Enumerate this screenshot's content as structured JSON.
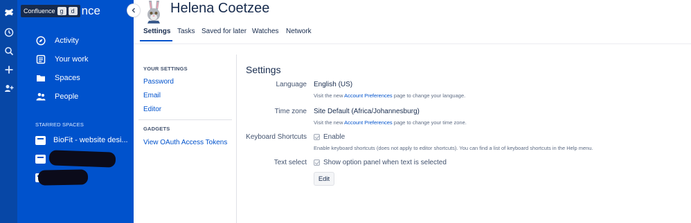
{
  "rail": {
    "icons": [
      "confluence-logo",
      "recent-icon",
      "search-icon",
      "create-icon",
      "invite-people-icon"
    ]
  },
  "sidebar": {
    "tooltip": {
      "label": "Confluence",
      "key1": "g",
      "key2": "d"
    },
    "brand_partial": "nce",
    "nav": [
      {
        "icon": "compass-icon",
        "label": "Activity"
      },
      {
        "icon": "document-icon",
        "label": "Your work"
      },
      {
        "icon": "folder-icon",
        "label": "Spaces"
      },
      {
        "icon": "people-icon",
        "label": "People"
      }
    ],
    "starred_heading": "STARRED SPACES",
    "starred": [
      {
        "label": "BioFit - website desi..."
      }
    ]
  },
  "header": {
    "name": "Helena Coetzee",
    "tabs": [
      "Settings",
      "Tasks",
      "Saved for later",
      "Watches",
      "Network"
    ],
    "active_tab": "Settings"
  },
  "menu": {
    "your_settings_heading": "YOUR SETTINGS",
    "your_settings": [
      "Password",
      "Email",
      "Editor"
    ],
    "gadgets_heading": "GADGETS",
    "gadgets": [
      "View OAuth Access Tokens"
    ]
  },
  "settings": {
    "title": "Settings",
    "language": {
      "label": "Language",
      "value": "English (US)",
      "help_pre": "Visit the new",
      "help_link": "Account Preferences",
      "help_post": "page to change your language."
    },
    "timezone": {
      "label": "Time zone",
      "value": "Site Default (Africa/Johannesburg)",
      "help_pre": "Visit the new",
      "help_link": "Account Preferences",
      "help_post": "page to change your time zone."
    },
    "shortcuts": {
      "label": "Keyboard Shortcuts",
      "option": "Enable",
      "checked": true,
      "help": "Enable keyboard shortcuts (does not apply to editor shortcuts). You can find a list of keyboard shortcuts in the Help menu."
    },
    "text_select": {
      "label": "Text select",
      "option": "Show option panel when text is selected",
      "checked": true
    },
    "edit_label": "Edit"
  }
}
